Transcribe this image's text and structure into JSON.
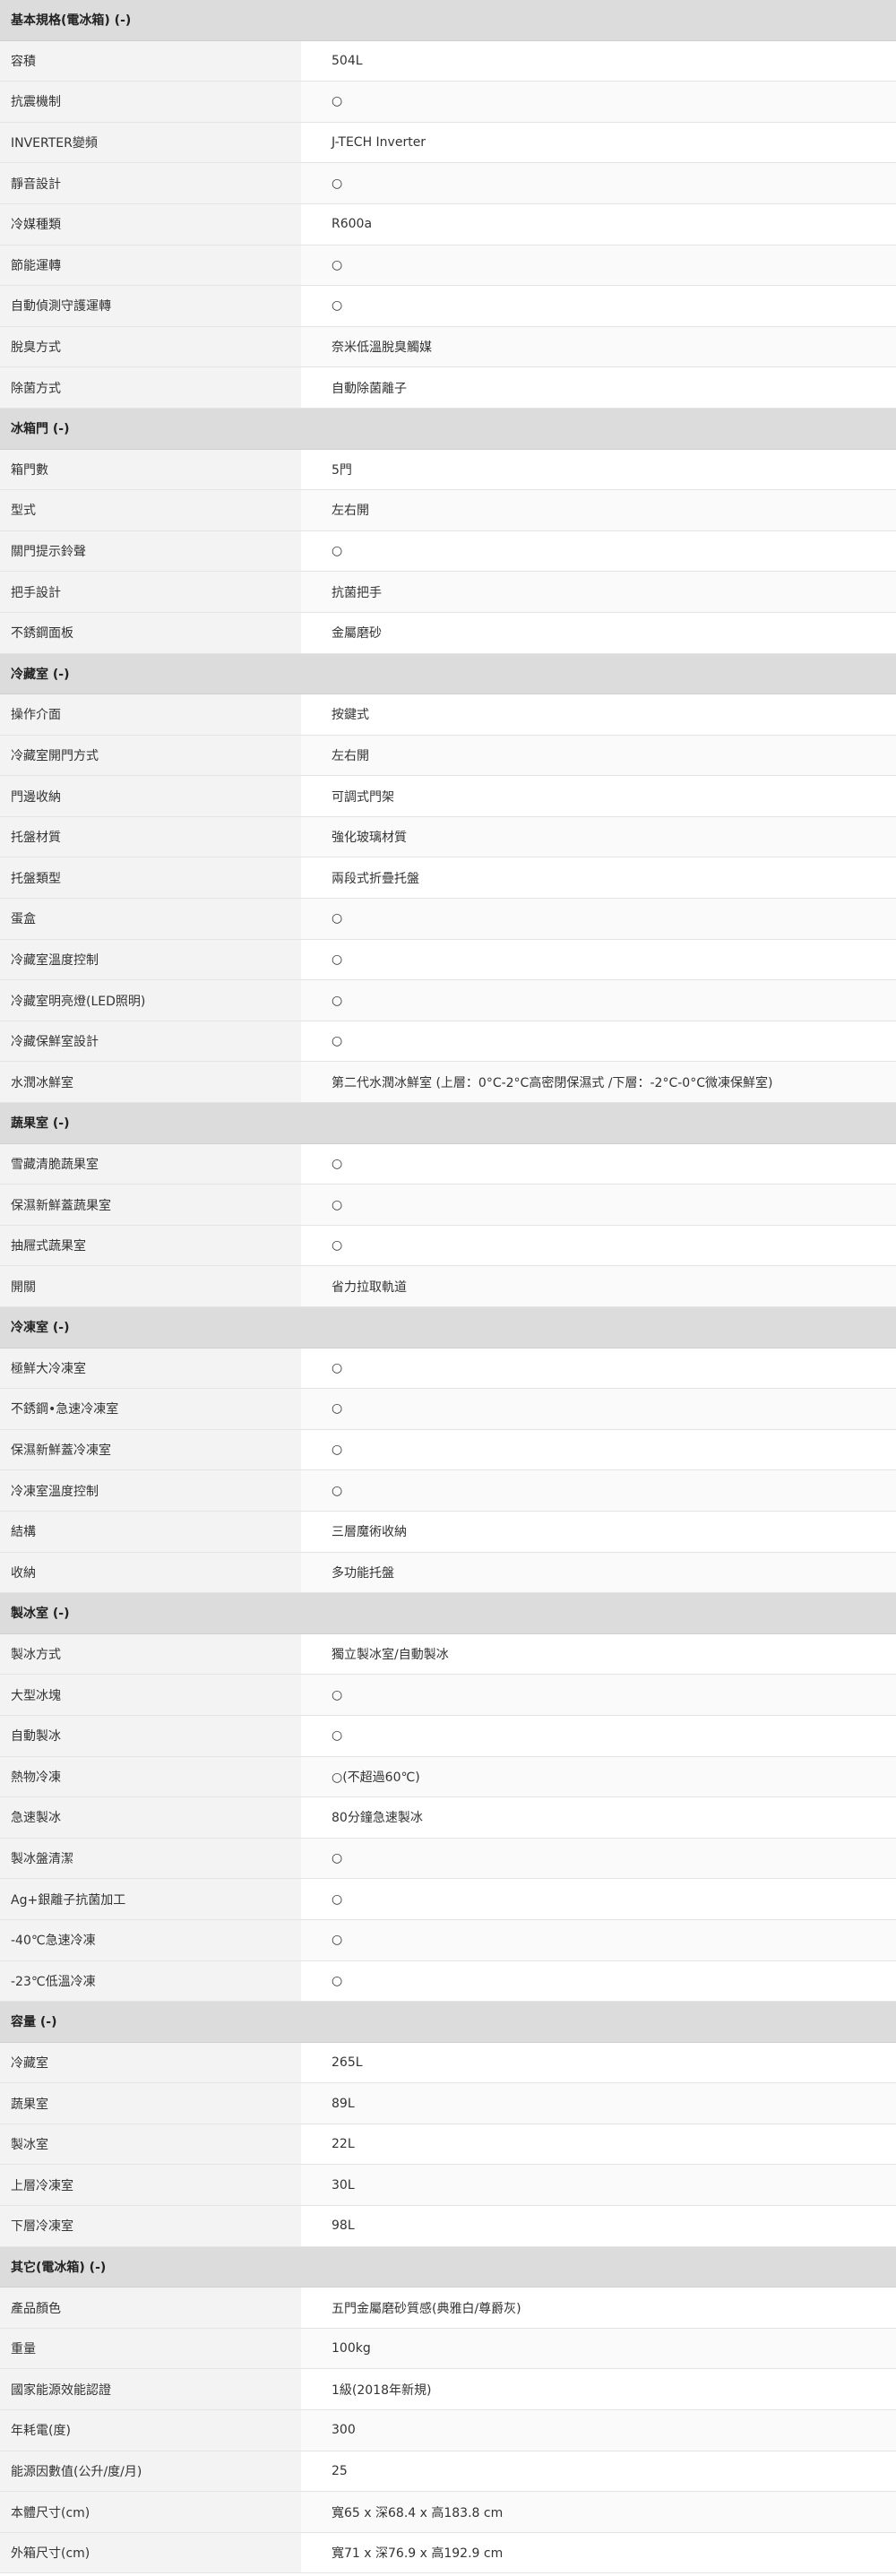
{
  "sections": [
    {
      "title": "基本規格(電冰箱) (-)",
      "rows": [
        {
          "label": "容積",
          "value": "504L"
        },
        {
          "label": "抗震機制",
          "value": "○"
        },
        {
          "label": "INVERTER變頻",
          "value": "J-TECH Inverter"
        },
        {
          "label": "靜音設計",
          "value": "○"
        },
        {
          "label": "冷媒種類",
          "value": "R600a"
        },
        {
          "label": "節能運轉",
          "value": "○"
        },
        {
          "label": "自動偵測守護運轉",
          "value": "○"
        },
        {
          "label": "脫臭方式",
          "value": "奈米低溫脫臭觸媒"
        },
        {
          "label": "除菌方式",
          "value": "自動除菌離子"
        }
      ]
    },
    {
      "title": "冰箱門 (-)",
      "rows": [
        {
          "label": "箱門數",
          "value": "5門"
        },
        {
          "label": "型式",
          "value": "左右開"
        },
        {
          "label": "關門提示鈴聲",
          "value": "○"
        },
        {
          "label": "把手設計",
          "value": "抗菌把手"
        },
        {
          "label": "不銹鋼面板",
          "value": "金屬磨砂"
        }
      ]
    },
    {
      "title": "冷藏室 (-)",
      "rows": [
        {
          "label": "操作介面",
          "value": "按鍵式"
        },
        {
          "label": "冷藏室開門方式",
          "value": "左右開"
        },
        {
          "label": "門邊收納",
          "value": "可調式門架"
        },
        {
          "label": "托盤材質",
          "value": "強化玻璃材質"
        },
        {
          "label": "托盤類型",
          "value": "兩段式折疊托盤"
        },
        {
          "label": "蛋盒",
          "value": "○"
        },
        {
          "label": "冷藏室溫度控制",
          "value": "○"
        },
        {
          "label": "冷藏室明亮燈(LED照明)",
          "value": "○"
        },
        {
          "label": "冷藏保鮮室設計",
          "value": "○"
        },
        {
          "label": "水潤冰鮮室",
          "value": "第二代水潤冰鮮室 (上層：0°C-2°C高密閉保濕式 /下層：-2°C-0°C微凍保鮮室)"
        }
      ]
    },
    {
      "title": "蔬果室 (-)",
      "rows": [
        {
          "label": "雪藏清脆蔬果室",
          "value": "○"
        },
        {
          "label": "保濕新鮮蓋蔬果室",
          "value": "○"
        },
        {
          "label": "抽屜式蔬果室",
          "value": "○"
        },
        {
          "label": "開關",
          "value": "省力拉取軌道"
        }
      ]
    },
    {
      "title": "冷凍室 (-)",
      "rows": [
        {
          "label": "極鮮大冷凍室",
          "value": "○"
        },
        {
          "label": "不銹鋼•急速冷凍室",
          "value": "○"
        },
        {
          "label": "保濕新鮮蓋冷凍室",
          "value": "○"
        },
        {
          "label": "冷凍室溫度控制",
          "value": "○"
        },
        {
          "label": "結構",
          "value": "三層魔術收納"
        },
        {
          "label": "收納",
          "value": "多功能托盤"
        }
      ]
    },
    {
      "title": "製冰室 (-)",
      "rows": [
        {
          "label": "製冰方式",
          "value": "獨立製冰室/自動製冰"
        },
        {
          "label": "大型冰塊",
          "value": "○"
        },
        {
          "label": "自動製冰",
          "value": "○"
        },
        {
          "label": "熱物冷凍",
          "value": "○(不超過60℃)"
        },
        {
          "label": "急速製冰",
          "value": "80分鐘急速製冰"
        },
        {
          "label": "製冰盤清潔",
          "value": "○"
        },
        {
          "label": "Ag+銀離子抗菌加工",
          "value": "○"
        },
        {
          "label": "-40℃急速冷凍",
          "value": "○"
        },
        {
          "label": "-23℃低溫冷凍",
          "value": "○"
        }
      ]
    },
    {
      "title": "容量 (-)",
      "rows": [
        {
          "label": "冷藏室",
          "value": "265L"
        },
        {
          "label": "蔬果室",
          "value": "89L"
        },
        {
          "label": "製冰室",
          "value": "22L"
        },
        {
          "label": "上層冷凍室",
          "value": "30L"
        },
        {
          "label": "下層冷凍室",
          "value": "98L"
        }
      ]
    },
    {
      "title": "其它(電冰箱) (-)",
      "rows": [
        {
          "label": "產品顏色",
          "value": "五門金屬磨砂質感(典雅白/尊爵灰)"
        },
        {
          "label": "重量",
          "value": "100kg"
        },
        {
          "label": "國家能源效能認證",
          "value": "1級(2018年新規)"
        },
        {
          "label": "年耗電(度)",
          "value": "300"
        },
        {
          "label": "能源因數值(公升/度/月)",
          "value": "25"
        },
        {
          "label": "本體尺寸(cm)",
          "value": "寬65 x 深68.4 x 高183.8 cm"
        },
        {
          "label": "外箱尺寸(cm)",
          "value": "寬71 x 深76.9 x 高192.9 cm"
        }
      ]
    }
  ]
}
